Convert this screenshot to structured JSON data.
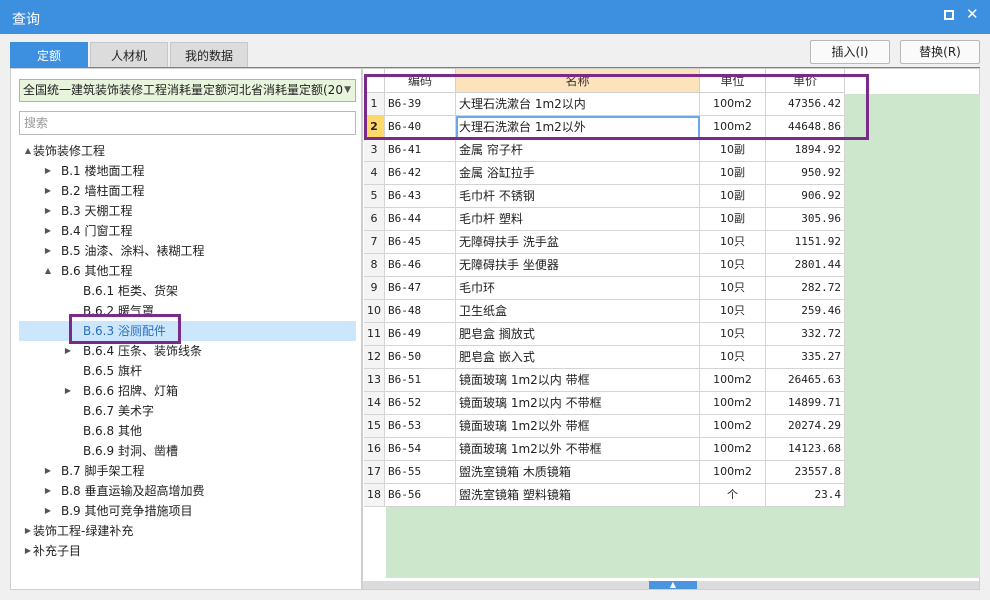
{
  "window": {
    "title": "查询"
  },
  "tabs": [
    {
      "label": "定额"
    },
    {
      "label": "人材机"
    },
    {
      "label": "我的数据"
    }
  ],
  "toolbar": {
    "insert_label": "插入(I)",
    "replace_label": "替换(R)"
  },
  "left": {
    "quota_book": "全国统一建筑装饰装修工程消耗量定额河北省消耗量定额(20",
    "search_placeholder": "搜索",
    "tree": [
      {
        "label": "装饰装修工程",
        "toggle": "▲"
      },
      {
        "label": "B.1 楼地面工程",
        "toggle": "▶"
      },
      {
        "label": "B.2 墙柱面工程",
        "toggle": "▶"
      },
      {
        "label": "B.3 天棚工程",
        "toggle": "▶"
      },
      {
        "label": "B.4 门窗工程",
        "toggle": "▶"
      },
      {
        "label": "B.5 油漆、涂料、裱糊工程",
        "toggle": "▶"
      },
      {
        "label": "B.6 其他工程",
        "toggle": "▲"
      },
      {
        "label": "B.6.1 柜类、货架",
        "toggle": ""
      },
      {
        "label": "B.6.2 暖气罩",
        "toggle": ""
      },
      {
        "label": "B.6.3 浴厕配件",
        "toggle": ""
      },
      {
        "label": "B.6.4 压条、装饰线条",
        "toggle": "▶"
      },
      {
        "label": "B.6.5 旗杆",
        "toggle": ""
      },
      {
        "label": "B.6.6 招牌、灯箱",
        "toggle": "▶"
      },
      {
        "label": "B.6.7 美术字",
        "toggle": ""
      },
      {
        "label": "B.6.8 其他",
        "toggle": ""
      },
      {
        "label": "B.6.9 封洞、凿槽",
        "toggle": ""
      },
      {
        "label": "B.7 脚手架工程",
        "toggle": "▶"
      },
      {
        "label": "B.8 垂直运输及超高增加费",
        "toggle": "▶"
      },
      {
        "label": "B.9 其他可竞争措施项目",
        "toggle": "▶"
      },
      {
        "label": "装饰工程-绿建补充",
        "toggle": "▶"
      },
      {
        "label": "补充子目",
        "toggle": "▶"
      }
    ]
  },
  "table": {
    "headers": {
      "code": "编码",
      "name": "名称",
      "unit": "单位",
      "price": "单价"
    },
    "rows": [
      {
        "no": "1",
        "code": "B6-39",
        "name": "大理石洗漱台 1m2以内",
        "unit": "100m2",
        "price": "47356.42"
      },
      {
        "no": "2",
        "code": "B6-40",
        "name": "大理石洗漱台 1m2以外",
        "unit": "100m2",
        "price": "44648.86"
      },
      {
        "no": "3",
        "code": "B6-41",
        "name": "金属 帘子杆",
        "unit": "10副",
        "price": "1894.92"
      },
      {
        "no": "4",
        "code": "B6-42",
        "name": "金属 浴缸拉手",
        "unit": "10副",
        "price": "950.92"
      },
      {
        "no": "5",
        "code": "B6-43",
        "name": "毛巾杆 不锈钢",
        "unit": "10副",
        "price": "906.92"
      },
      {
        "no": "6",
        "code": "B6-44",
        "name": "毛巾杆 塑料",
        "unit": "10副",
        "price": "305.96"
      },
      {
        "no": "7",
        "code": "B6-45",
        "name": "无障碍扶手 洗手盆",
        "unit": "10只",
        "price": "1151.92"
      },
      {
        "no": "8",
        "code": "B6-46",
        "name": "无障碍扶手 坐便器",
        "unit": "10只",
        "price": "2801.44"
      },
      {
        "no": "9",
        "code": "B6-47",
        "name": "毛巾环",
        "unit": "10只",
        "price": "282.72"
      },
      {
        "no": "10",
        "code": "B6-48",
        "name": "卫生纸盒",
        "unit": "10只",
        "price": "259.46"
      },
      {
        "no": "11",
        "code": "B6-49",
        "name": "肥皂盒 搁放式",
        "unit": "10只",
        "price": "332.72"
      },
      {
        "no": "12",
        "code": "B6-50",
        "name": "肥皂盒 嵌入式",
        "unit": "10只",
        "price": "335.27"
      },
      {
        "no": "13",
        "code": "B6-51",
        "name": "镜面玻璃 1m2以内 带框",
        "unit": "100m2",
        "price": "26465.63"
      },
      {
        "no": "14",
        "code": "B6-52",
        "name": "镜面玻璃 1m2以内 不带框",
        "unit": "100m2",
        "price": "14899.71"
      },
      {
        "no": "15",
        "code": "B6-53",
        "name": "镜面玻璃 1m2以外 带框",
        "unit": "100m2",
        "price": "20274.29"
      },
      {
        "no": "16",
        "code": "B6-54",
        "name": "镜面玻璃 1m2以外 不带框",
        "unit": "100m2",
        "price": "14123.68"
      },
      {
        "no": "17",
        "code": "B6-55",
        "name": "盥洗室镜箱 木质镜箱",
        "unit": "100m2",
        "price": "23557.8"
      },
      {
        "no": "18",
        "code": "B6-56",
        "name": "盥洗室镜箱 塑料镜箱",
        "unit": "个",
        "price": "23.4"
      }
    ]
  },
  "colors": {
    "accent": "#3d8fe0",
    "highlight_box": "#7b2a8a",
    "green_area": "#cde7cd"
  }
}
